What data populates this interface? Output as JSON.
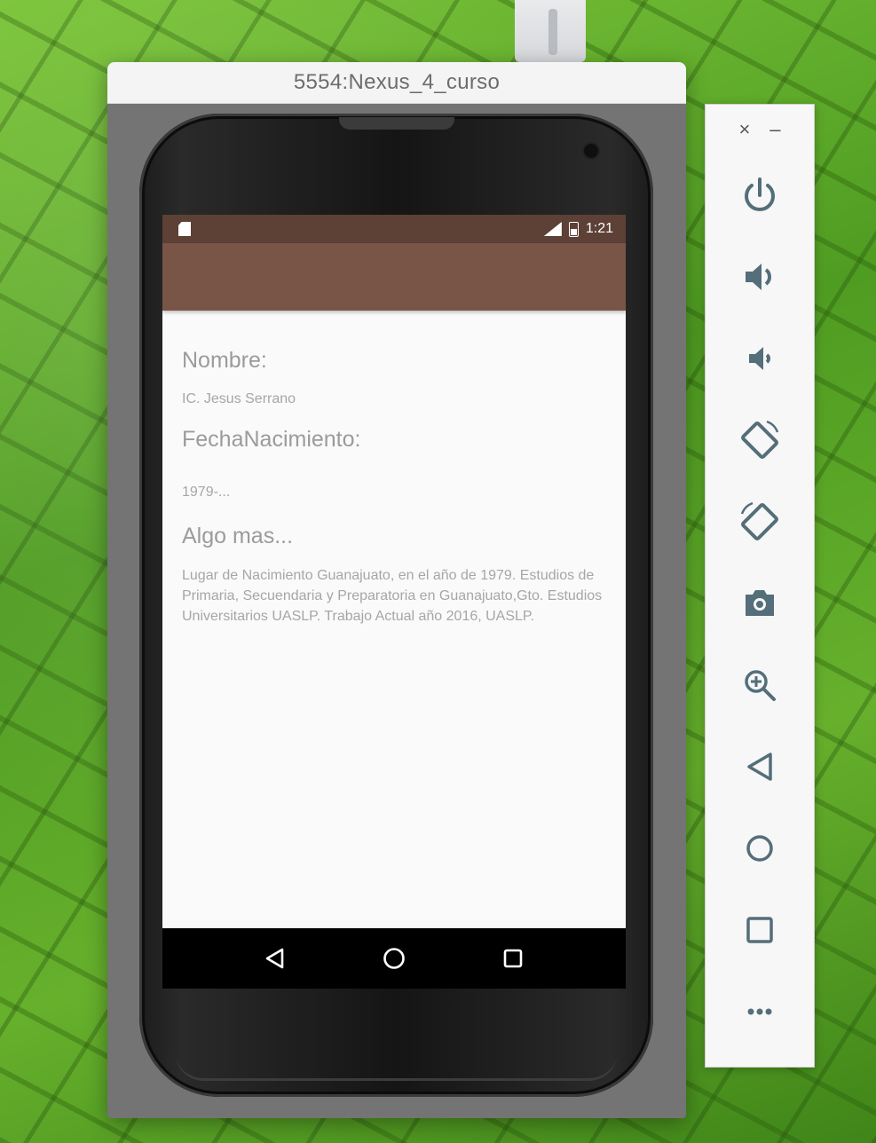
{
  "window": {
    "title": "5554:Nexus_4_curso"
  },
  "status_bar": {
    "time": "1:21"
  },
  "profile": {
    "name_label": "Nombre:",
    "name_value": "IC. Jesus Serrano",
    "birth_label": "FechaNacimiento:",
    "birth_value": "1979-...",
    "more_label": "Algo mas...",
    "more_value": "Lugar de Nacimiento Guanajuato, en el año de 1979. Estudios de Primaria, Secuendaria y Preparatoria en Guanajuato,Gto. Estudios Universitarios UASLP. Trabajo Actual año 2016, UASLP."
  },
  "nav_bar": {
    "icons": [
      "back-icon",
      "home-icon",
      "recents-icon"
    ]
  },
  "toolbar": {
    "close_glyph": "×",
    "minimize_glyph": "–",
    "tools": [
      "power-icon",
      "volume-up-icon",
      "volume-down-icon",
      "rotate-left-icon",
      "rotate-right-icon",
      "camera-icon",
      "zoom-icon",
      "back-icon",
      "home-icon",
      "overview-icon",
      "more-icon"
    ],
    "icon_color": "#546e7a"
  },
  "colors": {
    "status_bar": "#5d4036",
    "app_bar": "#795548"
  }
}
